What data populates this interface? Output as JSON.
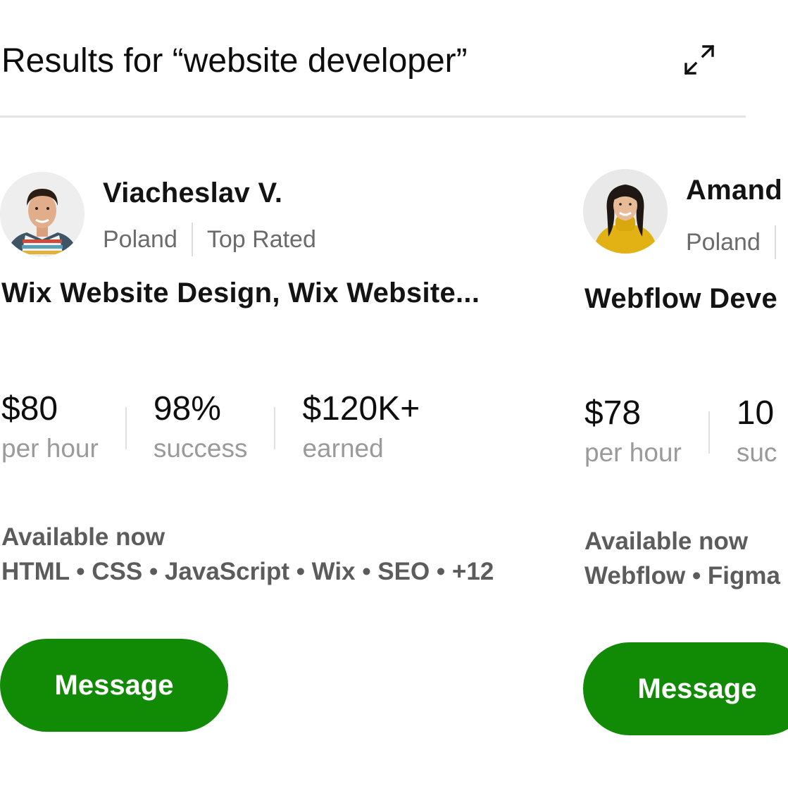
{
  "header": {
    "title": "Results for “website developer”",
    "expand_icon": "expand-arrows-icon"
  },
  "colors": {
    "accent": "#118a05",
    "muted_text": "#9a9a9a",
    "secondary_text": "#6b6b6b",
    "divider": "#e3e3e3"
  },
  "freelancers": [
    {
      "name": "Viacheslav V.",
      "country": "Poland",
      "badge": "Top Rated",
      "title": "Wix Website Design, Wix Website...",
      "stats": [
        {
          "value": "$80",
          "label": "per hour"
        },
        {
          "value": "98%",
          "label": "success"
        },
        {
          "value": "$120K+",
          "label": "earned"
        }
      ],
      "availability": "Available now",
      "skills": "HTML • CSS • JavaScript • Wix • SEO • +12",
      "button_label": "Message"
    },
    {
      "name": "Amand",
      "country": "Poland",
      "title": "Webflow Deve",
      "stats": [
        {
          "value": "$78",
          "label": "per hour"
        },
        {
          "value": "10",
          "label": "suc"
        }
      ],
      "availability": "Available now",
      "skills": "Webflow • Figma",
      "button_label": "Message"
    }
  ]
}
